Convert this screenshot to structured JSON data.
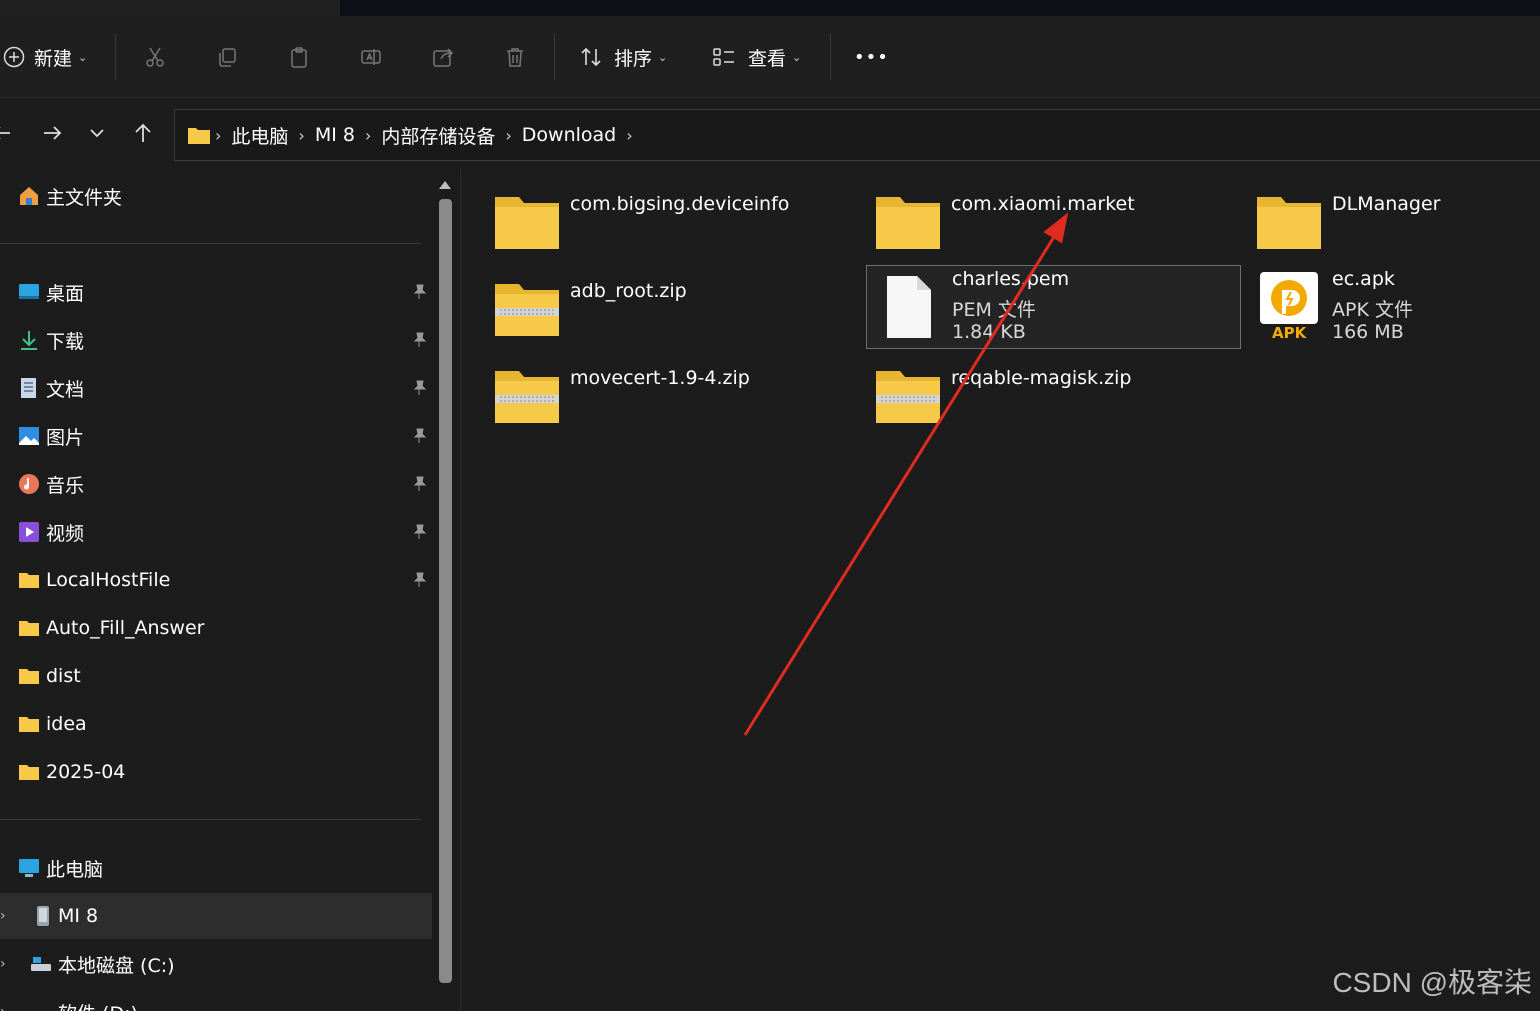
{
  "toolbar": {
    "new_label": "新建",
    "sort_label": "排序",
    "view_label": "查看",
    "more_label": "•••"
  },
  "address": {
    "crumbs": [
      "此电脑",
      "MI 8",
      "内部存储设备",
      "Download"
    ]
  },
  "sidebar": {
    "home": "主文件夹",
    "pinned": [
      "桌面",
      "下载",
      "文档",
      "图片",
      "音乐",
      "视频",
      "LocalHostFile"
    ],
    "folders": [
      "Auto_Fill_Answer",
      "dist",
      "idea",
      "2025-04"
    ],
    "this_pc": "此电脑",
    "devices": [
      "MI 8",
      "本地磁盘 (C:)",
      "软件 (D:)"
    ]
  },
  "files": [
    {
      "name": "com.bigsing.deviceinfo",
      "kind": "folder"
    },
    {
      "name": "com.xiaomi.market",
      "kind": "folder"
    },
    {
      "name": "DLManager",
      "kind": "folder"
    },
    {
      "name": "adb_root.zip",
      "kind": "zip"
    },
    {
      "name": "charles.pem",
      "kind": "doc",
      "type": "PEM 文件",
      "size": "1.84 KB"
    },
    {
      "name": "ec.apk",
      "kind": "apk",
      "type": "APK 文件",
      "size": "166 MB",
      "badge": "APK"
    },
    {
      "name": "movecert-1.9-4.zip",
      "kind": "zip"
    },
    {
      "name": "reqable-magisk.zip",
      "kind": "zip"
    }
  ],
  "watermark": "CSDN @极客柒",
  "colors": {
    "folder": "#f7c948",
    "accent_arrow": "#e02b20",
    "apk_brand": "#f2a900"
  }
}
